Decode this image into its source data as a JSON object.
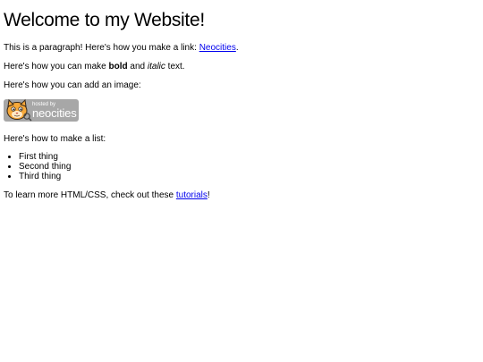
{
  "title": "Welcome to my Website!",
  "para1": {
    "text": "This is a paragraph! Here's how you make a link: ",
    "link": "Neocities",
    "after": "."
  },
  "para2": {
    "before": "Here's how you can make ",
    "bold": "bold",
    "middle": " and ",
    "italic": "italic",
    "after": " text."
  },
  "para3": "Here's how you can add an image:",
  "badge": {
    "small_text": "hosted by",
    "big_text": "neocities",
    "alt": "Site hosted by Neocities"
  },
  "list_intro": "Here's how to make a list:",
  "list_items": [
    "First thing",
    "Second thing",
    "Third thing"
  ],
  "para4": {
    "before": "To learn more HTML/CSS, check out these ",
    "link": "tutorials",
    "after": "!"
  },
  "colors": {
    "link": "#0000ee",
    "badge_bg": "#a7a7a7",
    "cat": "#f0a030"
  }
}
